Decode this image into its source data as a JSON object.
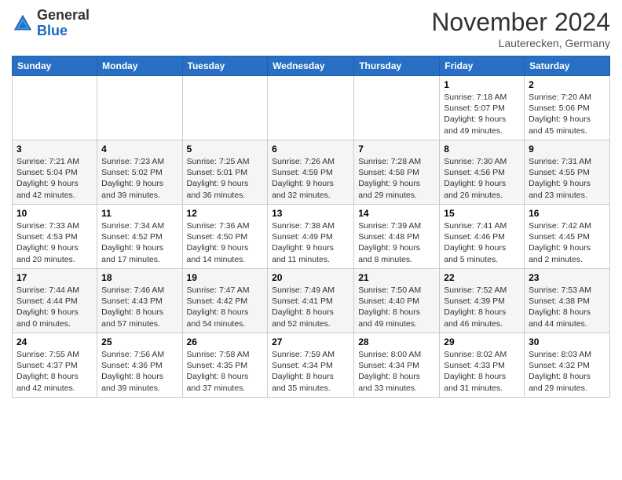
{
  "header": {
    "logo_general": "General",
    "logo_blue": "Blue",
    "month_title": "November 2024",
    "location": "Lauterecken, Germany"
  },
  "weekdays": [
    "Sunday",
    "Monday",
    "Tuesday",
    "Wednesday",
    "Thursday",
    "Friday",
    "Saturday"
  ],
  "weeks": [
    [
      {
        "day": "",
        "info": ""
      },
      {
        "day": "",
        "info": ""
      },
      {
        "day": "",
        "info": ""
      },
      {
        "day": "",
        "info": ""
      },
      {
        "day": "",
        "info": ""
      },
      {
        "day": "1",
        "info": "Sunrise: 7:18 AM\nSunset: 5:07 PM\nDaylight: 9 hours\nand 49 minutes."
      },
      {
        "day": "2",
        "info": "Sunrise: 7:20 AM\nSunset: 5:06 PM\nDaylight: 9 hours\nand 45 minutes."
      }
    ],
    [
      {
        "day": "3",
        "info": "Sunrise: 7:21 AM\nSunset: 5:04 PM\nDaylight: 9 hours\nand 42 minutes."
      },
      {
        "day": "4",
        "info": "Sunrise: 7:23 AM\nSunset: 5:02 PM\nDaylight: 9 hours\nand 39 minutes."
      },
      {
        "day": "5",
        "info": "Sunrise: 7:25 AM\nSunset: 5:01 PM\nDaylight: 9 hours\nand 36 minutes."
      },
      {
        "day": "6",
        "info": "Sunrise: 7:26 AM\nSunset: 4:59 PM\nDaylight: 9 hours\nand 32 minutes."
      },
      {
        "day": "7",
        "info": "Sunrise: 7:28 AM\nSunset: 4:58 PM\nDaylight: 9 hours\nand 29 minutes."
      },
      {
        "day": "8",
        "info": "Sunrise: 7:30 AM\nSunset: 4:56 PM\nDaylight: 9 hours\nand 26 minutes."
      },
      {
        "day": "9",
        "info": "Sunrise: 7:31 AM\nSunset: 4:55 PM\nDaylight: 9 hours\nand 23 minutes."
      }
    ],
    [
      {
        "day": "10",
        "info": "Sunrise: 7:33 AM\nSunset: 4:53 PM\nDaylight: 9 hours\nand 20 minutes."
      },
      {
        "day": "11",
        "info": "Sunrise: 7:34 AM\nSunset: 4:52 PM\nDaylight: 9 hours\nand 17 minutes."
      },
      {
        "day": "12",
        "info": "Sunrise: 7:36 AM\nSunset: 4:50 PM\nDaylight: 9 hours\nand 14 minutes."
      },
      {
        "day": "13",
        "info": "Sunrise: 7:38 AM\nSunset: 4:49 PM\nDaylight: 9 hours\nand 11 minutes."
      },
      {
        "day": "14",
        "info": "Sunrise: 7:39 AM\nSunset: 4:48 PM\nDaylight: 9 hours\nand 8 minutes."
      },
      {
        "day": "15",
        "info": "Sunrise: 7:41 AM\nSunset: 4:46 PM\nDaylight: 9 hours\nand 5 minutes."
      },
      {
        "day": "16",
        "info": "Sunrise: 7:42 AM\nSunset: 4:45 PM\nDaylight: 9 hours\nand 2 minutes."
      }
    ],
    [
      {
        "day": "17",
        "info": "Sunrise: 7:44 AM\nSunset: 4:44 PM\nDaylight: 9 hours\nand 0 minutes."
      },
      {
        "day": "18",
        "info": "Sunrise: 7:46 AM\nSunset: 4:43 PM\nDaylight: 8 hours\nand 57 minutes."
      },
      {
        "day": "19",
        "info": "Sunrise: 7:47 AM\nSunset: 4:42 PM\nDaylight: 8 hours\nand 54 minutes."
      },
      {
        "day": "20",
        "info": "Sunrise: 7:49 AM\nSunset: 4:41 PM\nDaylight: 8 hours\nand 52 minutes."
      },
      {
        "day": "21",
        "info": "Sunrise: 7:50 AM\nSunset: 4:40 PM\nDaylight: 8 hours\nand 49 minutes."
      },
      {
        "day": "22",
        "info": "Sunrise: 7:52 AM\nSunset: 4:39 PM\nDaylight: 8 hours\nand 46 minutes."
      },
      {
        "day": "23",
        "info": "Sunrise: 7:53 AM\nSunset: 4:38 PM\nDaylight: 8 hours\nand 44 minutes."
      }
    ],
    [
      {
        "day": "24",
        "info": "Sunrise: 7:55 AM\nSunset: 4:37 PM\nDaylight: 8 hours\nand 42 minutes."
      },
      {
        "day": "25",
        "info": "Sunrise: 7:56 AM\nSunset: 4:36 PM\nDaylight: 8 hours\nand 39 minutes."
      },
      {
        "day": "26",
        "info": "Sunrise: 7:58 AM\nSunset: 4:35 PM\nDaylight: 8 hours\nand 37 minutes."
      },
      {
        "day": "27",
        "info": "Sunrise: 7:59 AM\nSunset: 4:34 PM\nDaylight: 8 hours\nand 35 minutes."
      },
      {
        "day": "28",
        "info": "Sunrise: 8:00 AM\nSunset: 4:34 PM\nDaylight: 8 hours\nand 33 minutes."
      },
      {
        "day": "29",
        "info": "Sunrise: 8:02 AM\nSunset: 4:33 PM\nDaylight: 8 hours\nand 31 minutes."
      },
      {
        "day": "30",
        "info": "Sunrise: 8:03 AM\nSunset: 4:32 PM\nDaylight: 8 hours\nand 29 minutes."
      }
    ]
  ]
}
